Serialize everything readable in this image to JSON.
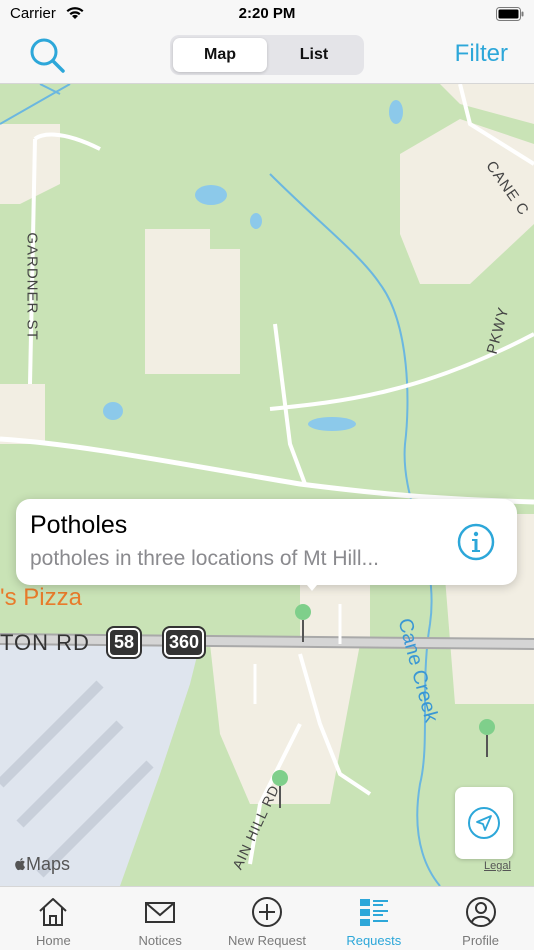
{
  "status_bar": {
    "carrier": "Carrier",
    "time": "2:20 PM"
  },
  "nav": {
    "segments": [
      "Map",
      "List"
    ],
    "active_segment": "Map",
    "filter_label": "Filter"
  },
  "map": {
    "labels": {
      "gardner_st": "GARDNER ST",
      "cane_creek_top": "CANE C",
      "pkwy": "PKWY",
      "pizza": "'s Pizza",
      "ton_rd": "TON RD",
      "route_58": "58",
      "route_360": "360",
      "cane_creek": "Cane Creek",
      "main_hill_rd": "AIN HILL RD"
    },
    "attribution": "Maps",
    "legal": "Legal"
  },
  "callout": {
    "title": "Potholes",
    "subtitle": "potholes in three locations of Mt Hill..."
  },
  "tabs": [
    {
      "label": "Home",
      "icon": "home-icon"
    },
    {
      "label": "Notices",
      "icon": "envelope-icon"
    },
    {
      "label": "New Request",
      "icon": "plus-circle-icon"
    },
    {
      "label": "Requests",
      "icon": "list-icon"
    },
    {
      "label": "Profile",
      "icon": "person-icon"
    }
  ],
  "active_tab": "Requests",
  "colors": {
    "accent": "#2da7d9",
    "park": "#c9e3b6",
    "urban": "#f2eee3",
    "water": "#8cc9ea",
    "pin": "#7fcf8b"
  }
}
